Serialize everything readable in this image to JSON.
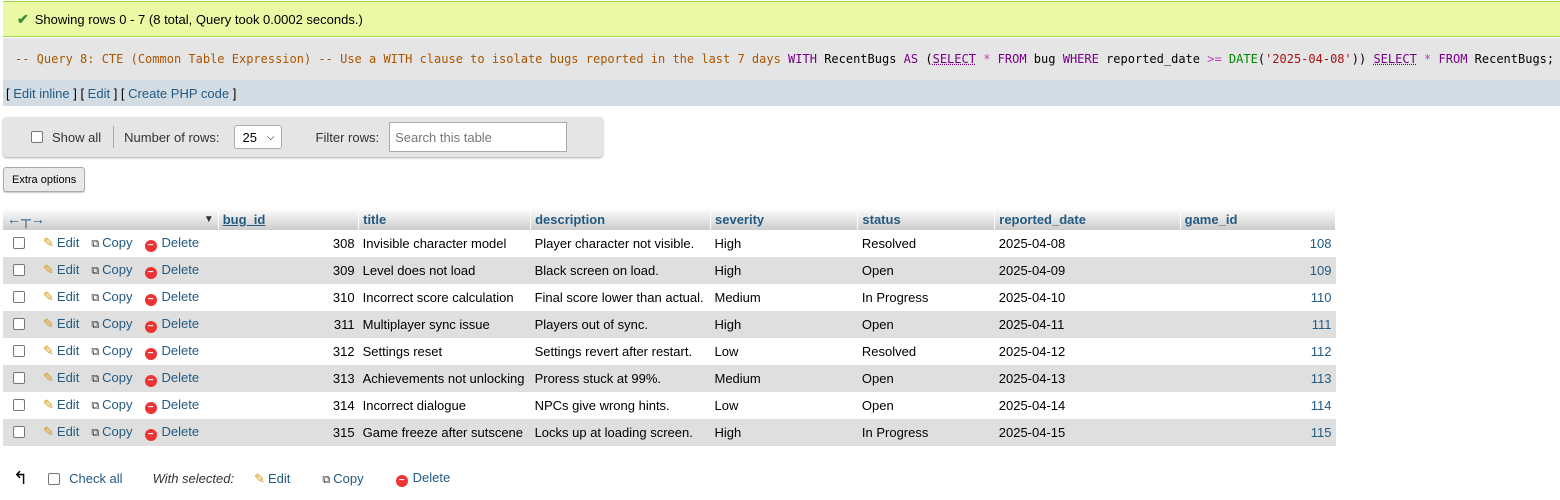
{
  "message": {
    "text": "Showing rows 0 - 7 (8 total, Query took 0.0002 seconds.)"
  },
  "sql": {
    "comment": "-- Query 8: CTE (Common Table Expression) -- Use a WITH clause to isolate bugs reported in the last 7 days",
    "kw_with": "WITH",
    "cte_name": "RecentBugs",
    "kw_as": "AS",
    "paren_open": "(",
    "kw_select1": "SELECT",
    "star1": "*",
    "kw_from1": "FROM",
    "table1": "bug",
    "kw_where": "WHERE",
    "col": "reported_date",
    "op": ">=",
    "fn": "DATE",
    "fn_open": "(",
    "str": "'2025-04-08'",
    "paren_close": "))",
    "kw_select2": "SELECT",
    "star2": "*",
    "kw_from2": "FROM",
    "table2": "RecentBugs;"
  },
  "links": {
    "edit_inline": "Edit inline",
    "edit": "Edit",
    "create_php": "Create PHP code"
  },
  "nav": {
    "show_all": "Show all",
    "number_of_rows_label": "Number of rows:",
    "rows_value": "25",
    "filter_label": "Filter rows:",
    "search_placeholder": "Search this table"
  },
  "extra_options": "Extra options",
  "table": {
    "columns": [
      "bug_id",
      "title",
      "description",
      "severity",
      "status",
      "reported_date",
      "game_id"
    ],
    "action_labels": {
      "edit": "Edit",
      "copy": "Copy",
      "delete": "Delete"
    },
    "rows": [
      {
        "bug_id": "308",
        "title": "Invisible character model",
        "description": "Player character not visible.",
        "severity": "High",
        "status": "Resolved",
        "reported_date": "2025-04-08",
        "game_id": "108"
      },
      {
        "bug_id": "309",
        "title": "Level does not load",
        "description": "Black screen on load.",
        "severity": "High",
        "status": "Open",
        "reported_date": "2025-04-09",
        "game_id": "109"
      },
      {
        "bug_id": "310",
        "title": "Incorrect score calculation",
        "description": "Final score lower than actual.",
        "severity": "Medium",
        "status": "In Progress",
        "reported_date": "2025-04-10",
        "game_id": "110"
      },
      {
        "bug_id": "311",
        "title": "Multiplayer sync issue",
        "description": "Players out of sync.",
        "severity": "High",
        "status": "Open",
        "reported_date": "2025-04-11",
        "game_id": "111"
      },
      {
        "bug_id": "312",
        "title": "Settings reset",
        "description": "Settings revert after restart.",
        "severity": "Low",
        "status": "Resolved",
        "reported_date": "2025-04-12",
        "game_id": "112"
      },
      {
        "bug_id": "313",
        "title": "Achievements not unlocking",
        "description": "Proress stuck at 99%.",
        "severity": "Medium",
        "status": "Open",
        "reported_date": "2025-04-13",
        "game_id": "113"
      },
      {
        "bug_id": "314",
        "title": "Incorrect dialogue",
        "description": "NPCs give wrong hints.",
        "severity": "Low",
        "status": "Open",
        "reported_date": "2025-04-14",
        "game_id": "114"
      },
      {
        "bug_id": "315",
        "title": "Game freeze after sutscene",
        "description": "Locks up at loading screen.",
        "severity": "High",
        "status": "In Progress",
        "reported_date": "2025-04-15",
        "game_id": "115"
      }
    ]
  },
  "bottom": {
    "check_all": "Check all",
    "with_selected": "With selected:",
    "edit": "Edit",
    "copy": "Copy",
    "delete": "Delete"
  },
  "colors": {
    "success_bg": "#ebf8a4",
    "link": "#235a81",
    "row_alt": "#dfdfdf"
  }
}
